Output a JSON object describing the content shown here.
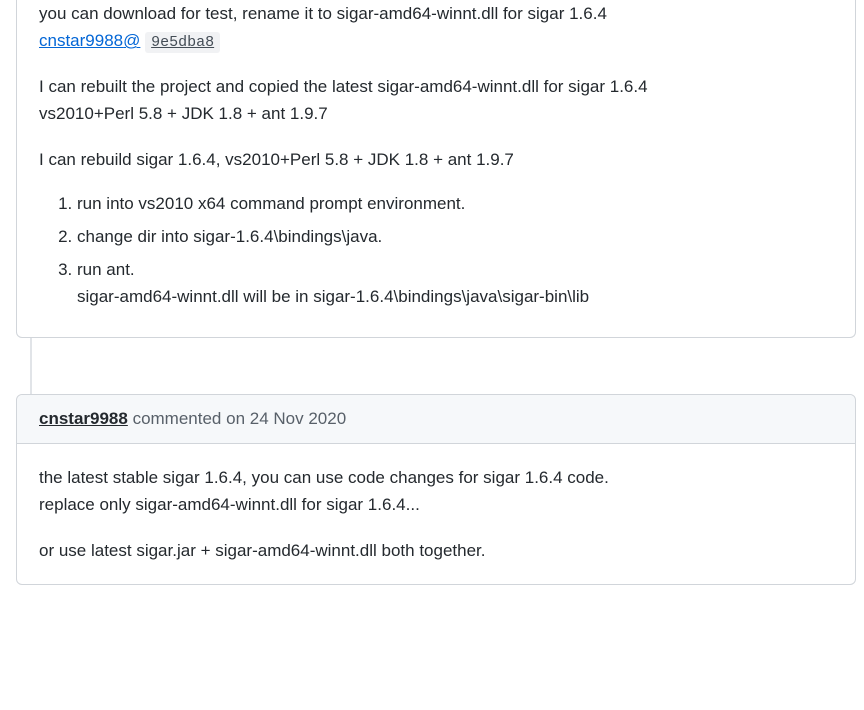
{
  "comment1": {
    "p1_pre": "you can download for test, rename it to sigar-amd64-winnt.dll for sigar 1.6.4",
    "mention": "cnstar9988",
    "at": "@",
    "commit_hash": "9e5dba8",
    "p2_line1": "I can rebuilt the project and copied the latest sigar-amd64-winnt.dll for sigar 1.6.4",
    "p2_line2": "vs2010+Perl 5.8 + JDK 1.8 + ant 1.9.7",
    "p3": "I can rebuild sigar 1.6.4, vs2010+Perl 5.8 + JDK 1.8 + ant 1.9.7",
    "steps": {
      "s1": "run into vs2010 x64 command prompt environment.",
      "s2": "change dir into sigar-1.6.4\\bindings\\java.",
      "s3": "run ant.",
      "s3b": "sigar-amd64-winnt.dll will be in sigar-1.6.4\\bindings\\java\\sigar-bin\\lib"
    }
  },
  "comment2": {
    "author": "cnstar9988",
    "action_date": " commented on 24 Nov 2020",
    "p1_line1": "the latest stable sigar 1.6.4, you can use code changes for sigar 1.6.4 code.",
    "p1_line2": "replace only sigar-amd64-winnt.dll for sigar 1.6.4...",
    "p2": "or use latest sigar.jar + sigar-amd64-winnt.dll both together."
  }
}
